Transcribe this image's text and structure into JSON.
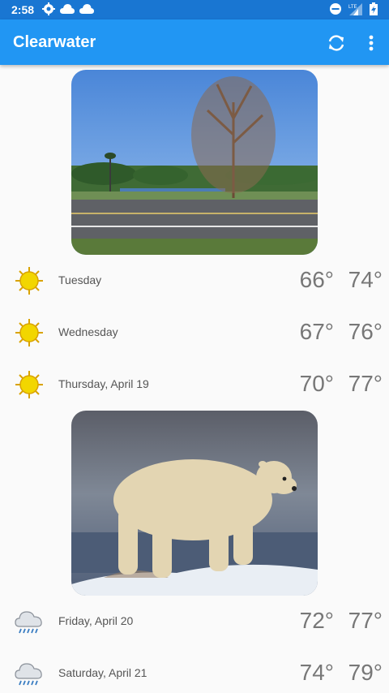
{
  "status_bar": {
    "time": "2:58",
    "icons": [
      "settings-icon",
      "cloud-icon",
      "cloud-icon",
      "do-not-disturb-icon",
      "lte-signal-icon",
      "battery-charging-icon"
    ],
    "network": "LTE"
  },
  "app_bar": {
    "title": "Clearwater",
    "actions": [
      "refresh-icon",
      "more-vert-icon"
    ]
  },
  "colors": {
    "status_bar": "#1976d2",
    "app_bar": "#2196f3",
    "sun": "#f2d600",
    "rain_drops": "#3a7dc2"
  },
  "forecast": [
    {
      "day": "Tuesday",
      "low": "66°",
      "high": "74°",
      "icon": "sun-icon"
    },
    {
      "day": "Wednesday",
      "low": "67°",
      "high": "76°",
      "icon": "sun-icon"
    },
    {
      "day": "Thursday, April 19",
      "low": "70°",
      "high": "77°",
      "icon": "sun-icon"
    },
    {
      "day": "Friday, April 20",
      "low": "72°",
      "high": "77°",
      "icon": "rain-cloud-icon"
    },
    {
      "day": "Saturday, April 21",
      "low": "74°",
      "high": "79°",
      "icon": "rain-cloud-icon"
    }
  ],
  "photos": [
    "landscape-photo",
    "polar-bear-photo"
  ]
}
